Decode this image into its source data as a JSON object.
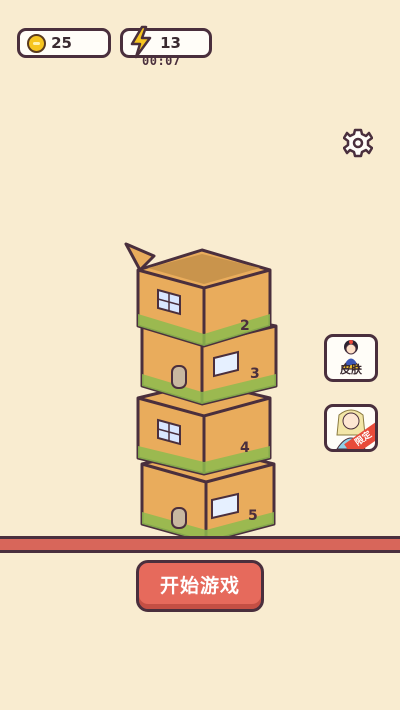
{
  "hud": {
    "coins": "25",
    "energy": "13",
    "timer": "00:07",
    "coin_icon": "coin-icon",
    "energy_icon": "lightning-icon"
  },
  "settings": {
    "icon": "gear-icon"
  },
  "side_buttons": {
    "skin_label": "皮肤",
    "limited_tag": "限定"
  },
  "tower": {
    "boxes": [
      {
        "number": "2"
      },
      {
        "number": "3"
      },
      {
        "number": "4"
      },
      {
        "number": "5"
      }
    ]
  },
  "start_button": {
    "label": "开始游戏"
  },
  "colors": {
    "background": "#f9ecd0",
    "box": "#e9ac5c",
    "box_dark": "#d7924a",
    "grass": "#8dbb4e",
    "outline": "#4a2f3d",
    "start_button": "#e66a5c",
    "ground": "#d8665a"
  }
}
